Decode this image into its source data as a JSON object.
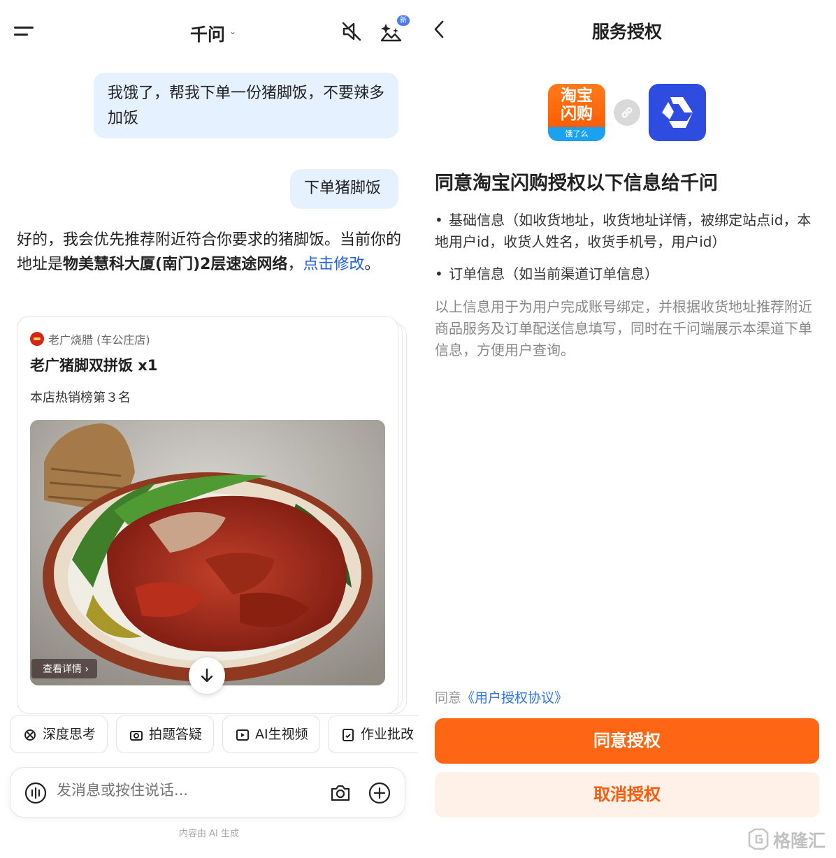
{
  "left": {
    "header": {
      "title": "千问",
      "caret": "⌄",
      "new_badge": "新"
    },
    "messages": {
      "user1": "我饿了，帮我下单一份猪脚饭，不要辣多加饭",
      "user2": "下单猪脚饭",
      "reply_part1": "好的，我会优先推荐附近符合你要求的猪脚饭。当前你的地址是",
      "reply_address": "物美慧科大厦(南门)2层速途网络",
      "reply_part2": "，",
      "reply_link": "点击修改",
      "reply_end": "。"
    },
    "card": {
      "shop_name": "老广烧腊 (车公庄店)",
      "dish_name": "老广猪脚双拼饭 x1",
      "rank": "本店热销榜第３名",
      "detail_button": "查看详情 ›"
    },
    "chips": [
      {
        "label": "深度思考",
        "icon": "deep-think-icon"
      },
      {
        "label": "拍题答疑",
        "icon": "camera-question-icon"
      },
      {
        "label": "AI生视频",
        "icon": "video-gen-icon"
      },
      {
        "label": "作业批改",
        "icon": "homework-icon"
      }
    ],
    "input": {
      "placeholder": "发消息或按住说话..."
    },
    "ai_note": "内容由 AI 生成"
  },
  "right": {
    "title": "服务授权",
    "taobao_logo": {
      "line1": "淘宝",
      "line2": "闪购",
      "line3": "饿了么"
    },
    "heading": "同意淘宝闪购授权以下信息给千问",
    "bullets": [
      "基础信息（如收货地址，收货地址详情，被绑定站点id，本地用户id，收货人姓名，收货手机号，用户id）",
      "订单信息（如当前渠道订单信息）"
    ],
    "note": "以上信息用于为用户完成账号绑定，并根据收货地址推荐附近商品服务及订单配送信息填写，同时在千问端展示本渠道下单信息，方便用户查询。",
    "agree_prefix": "同意",
    "agree_link": "《用户授权协议》",
    "agree_button": "同意授权",
    "cancel_button": "取消授权",
    "colors": {
      "accent": "#ff6613",
      "cancel_bg": "#fff0e8",
      "link": "#2f74e8"
    }
  },
  "watermark": "格隆汇"
}
